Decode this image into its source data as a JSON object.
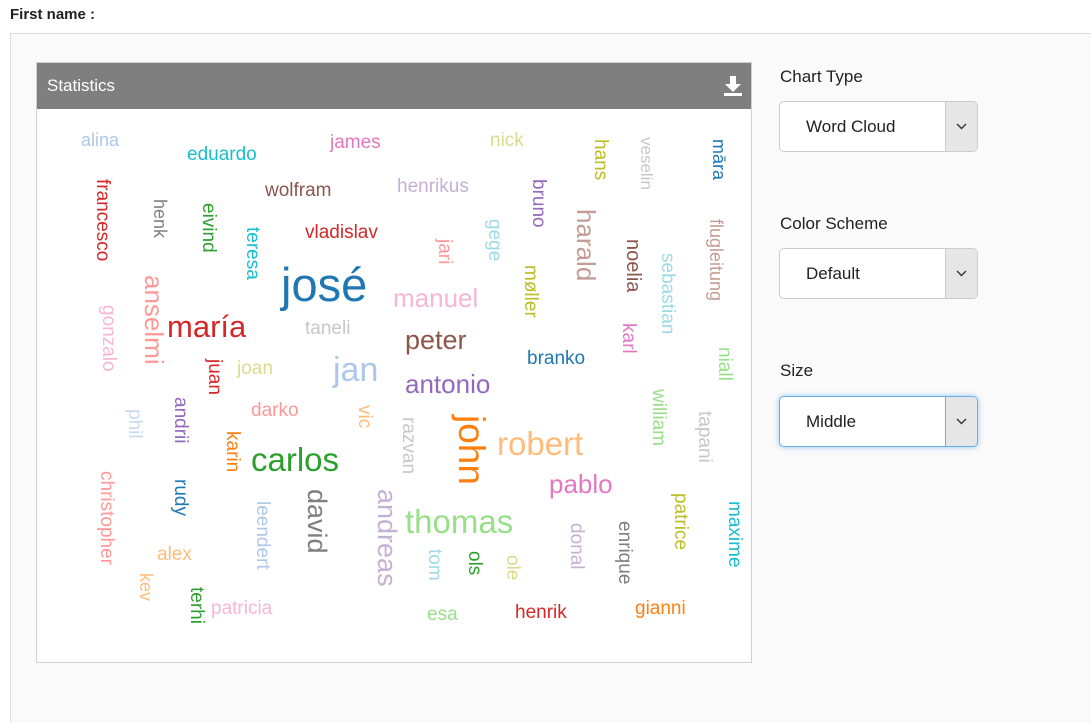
{
  "form": {
    "first_name_label": "First name :"
  },
  "stats": {
    "title": "Statistics",
    "words": [
      {
        "text": "alina",
        "color": "#aec7e8",
        "rot": 0
      },
      {
        "text": "eduardo",
        "color": "#17becf",
        "rot": 0
      },
      {
        "text": "james",
        "color": "#e377c2",
        "rot": 0
      },
      {
        "text": "nick",
        "color": "#dbdb8d",
        "rot": 0
      },
      {
        "text": "hans",
        "color": "#bcbd22",
        "rot": 90
      },
      {
        "text": "veselin",
        "color": "#c7c7c7",
        "rot": 90
      },
      {
        "text": "māra",
        "color": "#1f77b4",
        "rot": 90
      },
      {
        "text": "francesco",
        "color": "#d62728",
        "rot": 90
      },
      {
        "text": "henk",
        "color": "#7f7f7f",
        "rot": 90
      },
      {
        "text": "eivind",
        "color": "#2ca02c",
        "rot": 90
      },
      {
        "text": "wolfram",
        "color": "#8c564b",
        "rot": 0
      },
      {
        "text": "henrikus",
        "color": "#c5b0d5",
        "rot": 0
      },
      {
        "text": "bruno",
        "color": "#9467bd",
        "rot": 90
      },
      {
        "text": "harald",
        "color": "#c49c94",
        "rot": 90
      },
      {
        "text": "noelia",
        "color": "#8c564b",
        "rot": 90
      },
      {
        "text": "flugleitung",
        "color": "#c49c94",
        "rot": 90
      },
      {
        "text": "teresa",
        "color": "#17becf",
        "rot": 90
      },
      {
        "text": "vladislav",
        "color": "#d62728",
        "rot": 0
      },
      {
        "text": "jari",
        "color": "#ff9896",
        "rot": 90
      },
      {
        "text": "gege",
        "color": "#9edae5",
        "rot": 90
      },
      {
        "text": "sebastian",
        "color": "#9edae5",
        "rot": 90
      },
      {
        "text": "anselmi",
        "color": "#ff9896",
        "rot": 90
      },
      {
        "text": "gonzalo",
        "color": "#f7b6d2",
        "rot": 90
      },
      {
        "text": "josé",
        "color": "#1f77b4",
        "rot": 0
      },
      {
        "text": "møller",
        "color": "#bcbd22",
        "rot": 90
      },
      {
        "text": "manuel",
        "color": "#f7b6d2",
        "rot": 0
      },
      {
        "text": "karl",
        "color": "#e377c2",
        "rot": 90
      },
      {
        "text": "maría",
        "color": "#d62728",
        "rot": 0
      },
      {
        "text": "taneli",
        "color": "#c7c7c7",
        "rot": 0
      },
      {
        "text": "peter",
        "color": "#8c564b",
        "rot": 0
      },
      {
        "text": "niall",
        "color": "#98df8a",
        "rot": 90
      },
      {
        "text": "juan",
        "color": "#d62728",
        "rot": 90
      },
      {
        "text": "joan",
        "color": "#dbdb8d",
        "rot": 0
      },
      {
        "text": "jan",
        "color": "#aec7e8",
        "rot": 0
      },
      {
        "text": "branko",
        "color": "#1f77b4",
        "rot": 0
      },
      {
        "text": "antonio",
        "color": "#9467bd",
        "rot": 0
      },
      {
        "text": "phil",
        "color": "#c6dbef",
        "rot": 90
      },
      {
        "text": "andrii",
        "color": "#9467bd",
        "rot": 90
      },
      {
        "text": "darko",
        "color": "#ff9896",
        "rot": 0
      },
      {
        "text": "vic",
        "color": "#ffbb78",
        "rot": 90
      },
      {
        "text": "razvan",
        "color": "#c7c7c7",
        "rot": 90
      },
      {
        "text": "william",
        "color": "#98df8a",
        "rot": 90
      },
      {
        "text": "tapani",
        "color": "#c7c7c7",
        "rot": 90
      },
      {
        "text": "karin",
        "color": "#ff7f0e",
        "rot": 90
      },
      {
        "text": "john",
        "color": "#ff7f0e",
        "rot": 90
      },
      {
        "text": "robert",
        "color": "#ffbb78",
        "rot": 0
      },
      {
        "text": "carlos",
        "color": "#2ca02c",
        "rot": 0
      },
      {
        "text": "christopher",
        "color": "#ff9896",
        "rot": 90
      },
      {
        "text": "rudy",
        "color": "#1f77b4",
        "rot": 90
      },
      {
        "text": "pablo",
        "color": "#e377c2",
        "rot": 0
      },
      {
        "text": "leendert",
        "color": "#aec7e8",
        "rot": 90
      },
      {
        "text": "david",
        "color": "#7f7f7f",
        "rot": 90
      },
      {
        "text": "andreas",
        "color": "#c5b0d5",
        "rot": 90
      },
      {
        "text": "thomas",
        "color": "#98df8a",
        "rot": 0
      },
      {
        "text": "donal",
        "color": "#c5b0d5",
        "rot": 90
      },
      {
        "text": "enrique",
        "color": "#7f7f7f",
        "rot": 90
      },
      {
        "text": "patrice",
        "color": "#bcbd22",
        "rot": 90
      },
      {
        "text": "maxime",
        "color": "#17becf",
        "rot": 90
      },
      {
        "text": "alex",
        "color": "#ffbb78",
        "rot": 0
      },
      {
        "text": "kev",
        "color": "#ffbb78",
        "rot": 90
      },
      {
        "text": "terhi",
        "color": "#2ca02c",
        "rot": 90
      },
      {
        "text": "tom",
        "color": "#9edae5",
        "rot": 90
      },
      {
        "text": "ols",
        "color": "#2ca02c",
        "rot": 90
      },
      {
        "text": "ole",
        "color": "#dbdb8d",
        "rot": 90
      },
      {
        "text": "patricia",
        "color": "#f7b6d2",
        "rot": 0
      },
      {
        "text": "esa",
        "color": "#98df8a",
        "rot": 0
      },
      {
        "text": "henrik",
        "color": "#d62728",
        "rot": 0
      },
      {
        "text": "gianni",
        "color": "#ff7f0e",
        "rot": 0
      }
    ]
  },
  "controls": {
    "chart_type": {
      "label": "Chart Type",
      "value": "Word Cloud"
    },
    "color_scheme": {
      "label": "Color Scheme",
      "value": "Default"
    },
    "size": {
      "label": "Size",
      "value": "Middle"
    }
  }
}
